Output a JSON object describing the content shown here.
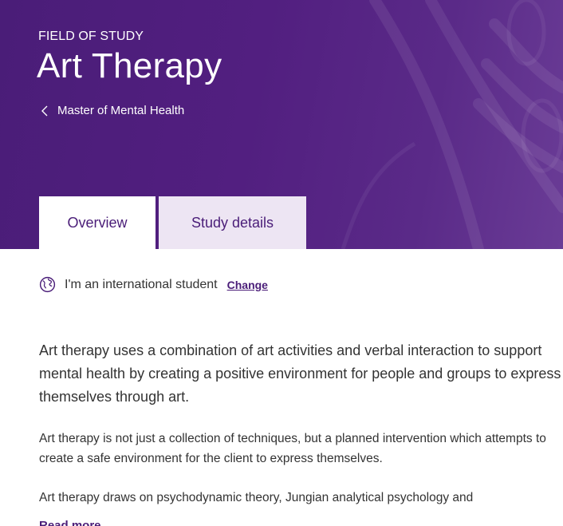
{
  "hero": {
    "eyebrow": "FIELD OF STUDY",
    "title": "Art Therapy",
    "breadcrumb": "Master of Mental Health",
    "background_color": "#521f80"
  },
  "tabs": [
    {
      "label": "Overview",
      "active": true
    },
    {
      "label": "Study details",
      "active": false
    }
  ],
  "student_type": {
    "label": "I'm an international student",
    "change_link": "Change"
  },
  "content": {
    "lead": "Art therapy uses a combination of art activities and verbal interaction to support mental health by creating a positive environment for people and groups to express themselves through art.",
    "paragraphs": [
      "Art therapy is not just a collection of techniques, but a planned intervention which attempts to create a safe environment for the client to express themselves.",
      "Art therapy draws on psychodynamic theory, Jungian analytical psychology and"
    ],
    "read_more": "Read more"
  },
  "colors": {
    "accent": "#4a1d78",
    "inactive_tab": "#ede5f3"
  }
}
